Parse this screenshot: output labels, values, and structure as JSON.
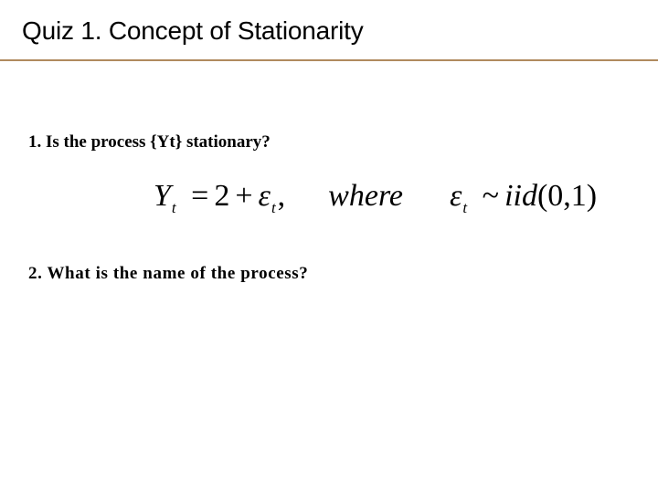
{
  "slide": {
    "title": "Quiz 1. Concept of Stationarity",
    "rule_color": "#b08a5e"
  },
  "questions": [
    {
      "text": "1. Is the process {Yt} stationary?"
    },
    {
      "text": "2. What is the name of the process?"
    }
  ],
  "equation": {
    "lhs_var": "Y",
    "lhs_sub": "t",
    "equals": "=",
    "constant": "2",
    "plus": "+",
    "error_var": "ε",
    "error_sub": "t",
    "comma": ",",
    "where": "where",
    "cond_var": "ε",
    "cond_sub": "t",
    "tilde": "~",
    "dist": "iid",
    "params": "(0,1)"
  }
}
